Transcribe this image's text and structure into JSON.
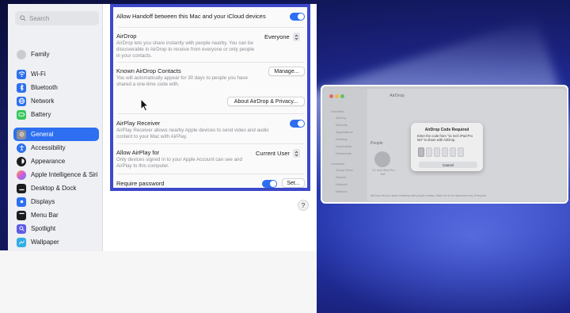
{
  "sidebar": {
    "search_placeholder": "Search",
    "family": "Family",
    "items": [
      {
        "label": "Wi-Fi",
        "icon": "wifi-icon",
        "color": "#2d6ff0"
      },
      {
        "label": "Bluetooth",
        "icon": "bluetooth-icon",
        "color": "#2d6ff0"
      },
      {
        "label": "Network",
        "icon": "globe-icon",
        "color": "#2d6ff0"
      },
      {
        "label": "Battery",
        "icon": "battery-icon",
        "color": "#34c759"
      },
      {
        "label": "General",
        "icon": "gear-icon",
        "color": "#8e8e93",
        "active": true
      },
      {
        "label": "Accessibility",
        "icon": "accessibility-icon",
        "color": "#2d6ff0"
      },
      {
        "label": "Appearance",
        "icon": "appearance-icon",
        "color": "#1d1d1f"
      },
      {
        "label": "Apple Intelligence & Siri",
        "icon": "siri-icon",
        "color": "#d65ad8"
      },
      {
        "label": "Desktop & Dock",
        "icon": "dock-icon",
        "color": "#1d1d1f"
      },
      {
        "label": "Displays",
        "icon": "display-icon",
        "color": "#2d6ff0"
      },
      {
        "label": "Menu Bar",
        "icon": "menubar-icon",
        "color": "#1d1d1f"
      },
      {
        "label": "Spotlight",
        "icon": "spotlight-icon",
        "color": "#5e5ce6"
      },
      {
        "label": "Wallpaper",
        "icon": "wallpaper-icon",
        "color": "#32ade6"
      }
    ]
  },
  "panel": {
    "handoff": "Allow Handoff between this Mac and your iCloud devices",
    "airdrop_title": "AirDrop",
    "airdrop_desc": "AirDrop lets you share instantly with people nearby. You can be discoverable in AirDrop to receive from everyone or only people in your contacts.",
    "airdrop_value": "Everyone",
    "known_title": "Known AirDrop Contacts",
    "known_desc": "You will automatically appear for 30 days to people you have shared a one-time code with.",
    "manage_btn": "Manage...",
    "about_btn": "About AirDrop & Privacy...",
    "airplay_title": "AirPlay Receiver",
    "airplay_desc": "AirPlay Receiver allows nearby Apple devices to send video and audio content to your Mac with AirPlay.",
    "allow_airplay_title": "Allow AirPlay for",
    "allow_airplay_desc": "Only devices signed in to your Apple Account can see and AirPlay to this computer.",
    "allow_airplay_value": "Current User",
    "require_password": "Require password",
    "set_btn": "Set...",
    "help": "?"
  },
  "airdrop_window": {
    "title": "AirDrop",
    "sidebar_section": "Favorites",
    "sidebar_items": [
      "AirDrop",
      "Recents",
      "Applications",
      "Desktop",
      "Documents",
      "Downloads"
    ],
    "sidebar_section2": "Locations",
    "sidebar_items2": [
      "iCloud Drive",
      "Shared",
      "Network",
      "Network"
    ],
    "people": "People",
    "device_name": "\"11 Inch iPad Pro M4\"",
    "footer": "AirDrop lets you share instantly with people nearby. Allow me to be discovered by: Everyone",
    "dialog_title": "AirDrop Code Required",
    "dialog_msg": "Enter the code from \"11 Inch iPad Pro M4\" to share with AirDrop.",
    "cancel": "Cancel"
  }
}
